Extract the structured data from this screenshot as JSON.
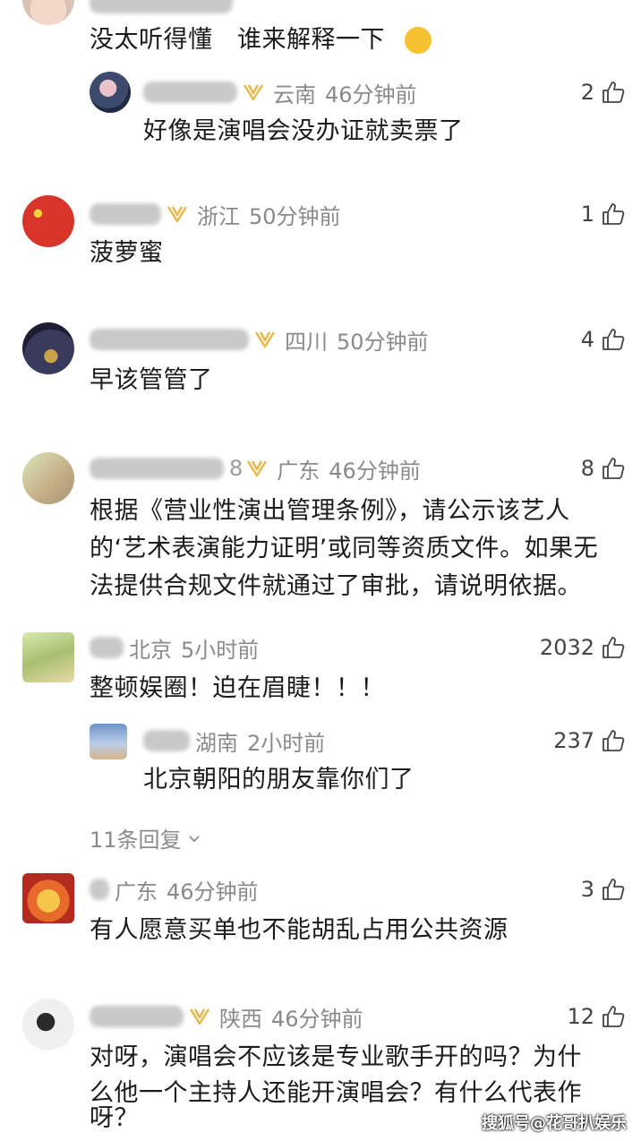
{
  "comments": [
    {
      "text": "没太听得懂　谁来解释一下"
    },
    {
      "location": "云南",
      "time": "46分钟前",
      "likes": "2",
      "text": "好像是演唱会没办证就卖票了"
    },
    {
      "location": "浙江",
      "time": "50分钟前",
      "likes": "1",
      "text": "菠萝蜜"
    },
    {
      "location": "四川",
      "time": "50分钟前",
      "likes": "4",
      "text": "早该管管了"
    },
    {
      "location": "广东",
      "time": "46分钟前",
      "likes": "8",
      "text_lines": [
        "根据《营业性演出管理条例》，请公示该艺人",
        "的‘艺术表演能力证明’或同等资质文件。如果无",
        "法提供合规文件就通过了审批，请说明依据。"
      ]
    },
    {
      "location": "北京",
      "time": "5小时前",
      "likes": "2032",
      "text": "整顿娱圈！迫在眉睫！！！"
    },
    {
      "location": "湖南",
      "time": "2小时前",
      "likes": "237",
      "text": "北京朝阳的朋友靠你们了"
    },
    {
      "location": "广东",
      "time": "46分钟前",
      "likes": "3",
      "text": "有人愿意买单也不能胡乱占用公共资源"
    },
    {
      "location": "陕西",
      "time": "46分钟前",
      "likes": "12",
      "text_lines": [
        "对呀，演唱会不应该是专业歌手开的吗？为什",
        "么他一个主持人还能开演唱会？有什么代表作",
        "呀？"
      ]
    }
  ],
  "more_replies": "11条回复",
  "name_fragment": "8",
  "watermark": "搜狐号@花哥扒娱乐",
  "icons": {
    "vip": "vip-badge-icon",
    "like": "thumbs-up-icon",
    "expand": "chevron-down-icon"
  },
  "colors": {
    "vip": "#e8b84a",
    "meta": "#8a8a8a",
    "text": "#1c1c1c"
  }
}
